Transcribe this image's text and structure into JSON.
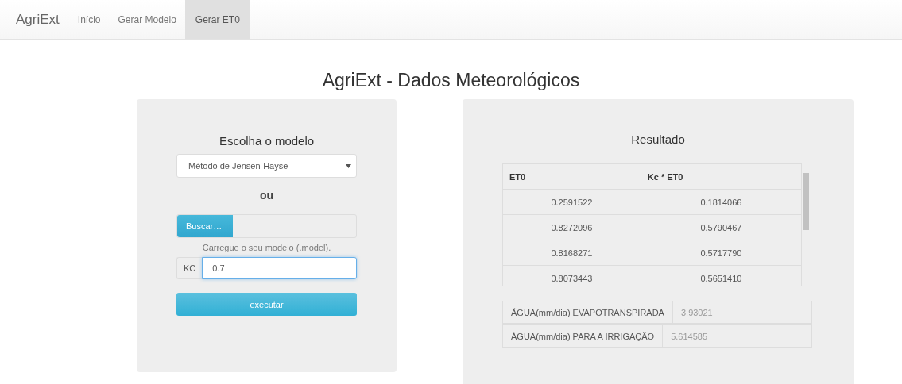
{
  "navbar": {
    "brand": "AgriExt",
    "items": [
      {
        "label": "Início",
        "selected": false
      },
      {
        "label": "Gerar Modelo",
        "selected": false
      },
      {
        "label": "Gerar ET0",
        "selected": true
      }
    ]
  },
  "title": "AgriExt - Dados Meteorológicos",
  "model_panel": {
    "heading": "Escolha o modelo",
    "select": {
      "value": "Método de Jensen-Hayse"
    },
    "separator": "ou",
    "file": {
      "button": "Buscar…",
      "help": "Carregue o seu modelo (.model)."
    },
    "kc": {
      "label": "KC",
      "value": "0.7"
    },
    "run_button": "executar"
  },
  "result_panel": {
    "heading": "Resultado",
    "table": {
      "columns": [
        "ET0",
        "Kc * ET0"
      ],
      "rows": [
        [
          "0.2591522",
          "0.1814066"
        ],
        [
          "0.8272096",
          "0.5790467"
        ],
        [
          "0.8168271",
          "0.5717790"
        ],
        [
          "0.8073443",
          "0.5651410"
        ]
      ]
    },
    "outputs": [
      {
        "label": "ÁGUA(mm/dia) EVAPOTRANSPIRADA",
        "value": "3.93021"
      },
      {
        "label": "ÁGUA(mm/dia) PARA A IRRIGAÇÃO",
        "value": "5.614585"
      }
    ]
  }
}
